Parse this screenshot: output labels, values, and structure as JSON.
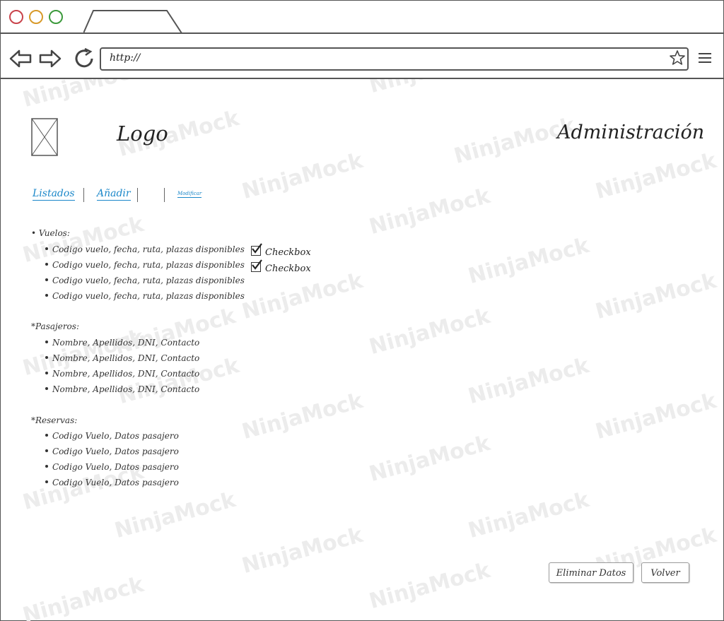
{
  "browser": {
    "address_text": "http://",
    "icons": [
      "back-arrow-icon",
      "forward-arrow-icon",
      "refresh-icon",
      "star-icon",
      "hamburger-menu-icon"
    ]
  },
  "watermark": "NinjaMock",
  "header": {
    "logo_text": "Logo",
    "title": "Administración"
  },
  "nav": {
    "links": [
      "Listados",
      "Añadir",
      "Modificar"
    ]
  },
  "vuelos": {
    "heading": "• Vuelos:",
    "items": [
      "Codigo vuelo, fecha, ruta, plazas disponibles",
      "Codigo vuelo, fecha, ruta, plazas disponibles",
      "Codigo vuelo, fecha, ruta, plazas disponibles",
      "Codigo vuelo, fecha, ruta, plazas disponibles"
    ],
    "checkboxes": [
      {
        "label": "Checkbox",
        "checked": true
      },
      {
        "label": "Checkbox",
        "checked": true
      }
    ]
  },
  "pasajeros": {
    "heading": "*Pasajeros:",
    "items": [
      "Nombre, Apellidos, DNI, Contacto",
      "Nombre, Apellidos, DNI, Contacto",
      "Nombre, Apellidos, DNI, Contacto",
      "Nombre, Apellidos, DNI, Contacto"
    ]
  },
  "reservas": {
    "heading": "*Reservas:",
    "items": [
      "Codigo Vuelo, Datos pasajero",
      "Codigo Vuelo, Datos pasajero",
      "Codigo Vuelo, Datos pasajero",
      "Codigo Vuelo, Datos pasajero"
    ]
  },
  "actions": {
    "delete_label": "Eliminar Datos",
    "back_label": "Volver"
  }
}
